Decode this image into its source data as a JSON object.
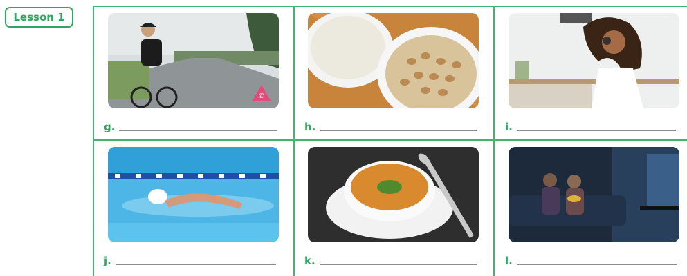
{
  "lesson": {
    "label": "Lesson 1"
  },
  "items": [
    {
      "letter": "g.",
      "icon": "cycling-photo"
    },
    {
      "letter": "h.",
      "icon": "rice-and-beans-photo"
    },
    {
      "letter": "i.",
      "icon": "listening-to-music-photo"
    },
    {
      "letter": "j.",
      "icon": "swimming-photo"
    },
    {
      "letter": "k.",
      "icon": "soup-photo"
    },
    {
      "letter": "l.",
      "icon": "watching-tv-photo"
    }
  ],
  "colors": {
    "accent": "#2fa85f",
    "grid": "#3fb56e",
    "line": "#8a8a8a"
  }
}
